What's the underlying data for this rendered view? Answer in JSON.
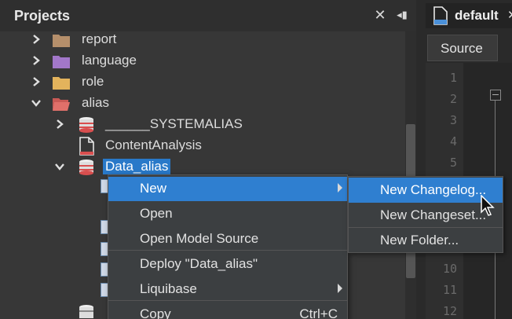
{
  "projects_panel": {
    "title": "Projects",
    "close_glyph": "✕",
    "minimize_glyph": "◂▮"
  },
  "tree": {
    "items": [
      {
        "label": "report",
        "icon": "folder-icon",
        "color": "#b58f6b",
        "expanded": false
      },
      {
        "label": "language",
        "icon": "folder-icon",
        "color": "#a277c9",
        "expanded": false
      },
      {
        "label": "role",
        "icon": "folder-icon",
        "color": "#e3b35c",
        "expanded": false
      },
      {
        "label": "alias",
        "icon": "folder-open-icon",
        "color": "#e0706a",
        "expanded": true
      },
      {
        "label": "______SYSTEMALIAS",
        "icon": "database-icon",
        "expanded": false
      },
      {
        "label": "ContentAnalysis",
        "icon": "file-icon",
        "expanded": null
      },
      {
        "label": "Data_alias",
        "icon": "database-icon",
        "expanded": true,
        "selected": true
      }
    ]
  },
  "editor": {
    "tab_title": "default",
    "tab_close": "✕",
    "source_tab": "Source",
    "line_numbers": [
      "1",
      "2",
      "3",
      "4",
      "5",
      "10",
      "11",
      "12"
    ]
  },
  "context_menu": {
    "items": [
      {
        "label": "New",
        "submenu": true,
        "active": true
      },
      {
        "label": "Open"
      },
      {
        "label": "Open Model Source"
      },
      {
        "label": "Deploy \"Data_alias\""
      },
      {
        "label": "Liquibase",
        "submenu": true
      },
      {
        "label": "Copy",
        "shortcut": "Ctrl+C"
      }
    ]
  },
  "submenu": {
    "items": [
      {
        "label": "New Changelog...",
        "active": true
      },
      {
        "label": "New Changeset..."
      },
      {
        "label": "New Folder..."
      }
    ]
  },
  "colors": {
    "selection": "#2f7fd0",
    "panel_bg": "#373737",
    "database": "#d94f4f"
  }
}
